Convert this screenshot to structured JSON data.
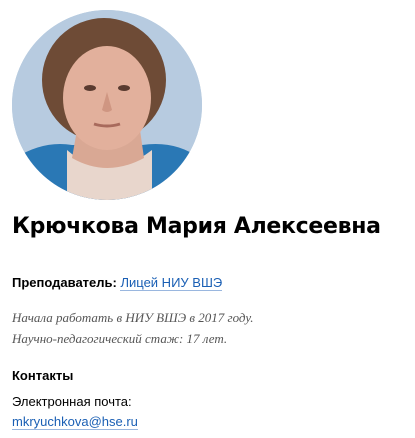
{
  "profile": {
    "name": "Крючкова Мария Алексеевна",
    "position_label": "Преподаватель:",
    "position_link": "Лицей НИУ ВШЭ",
    "bio": [
      "Начала работать в НИУ ВШЭ в 2017 году.",
      "Научно-педагогический стаж: 17 лет."
    ]
  },
  "contacts": {
    "title": "Контакты",
    "email_label": "Электронная почта:",
    "email": "mkryuchkova@hse.ru"
  },
  "colors": {
    "link": "#1a5fb4",
    "text": "#000000",
    "muted": "#555555"
  }
}
